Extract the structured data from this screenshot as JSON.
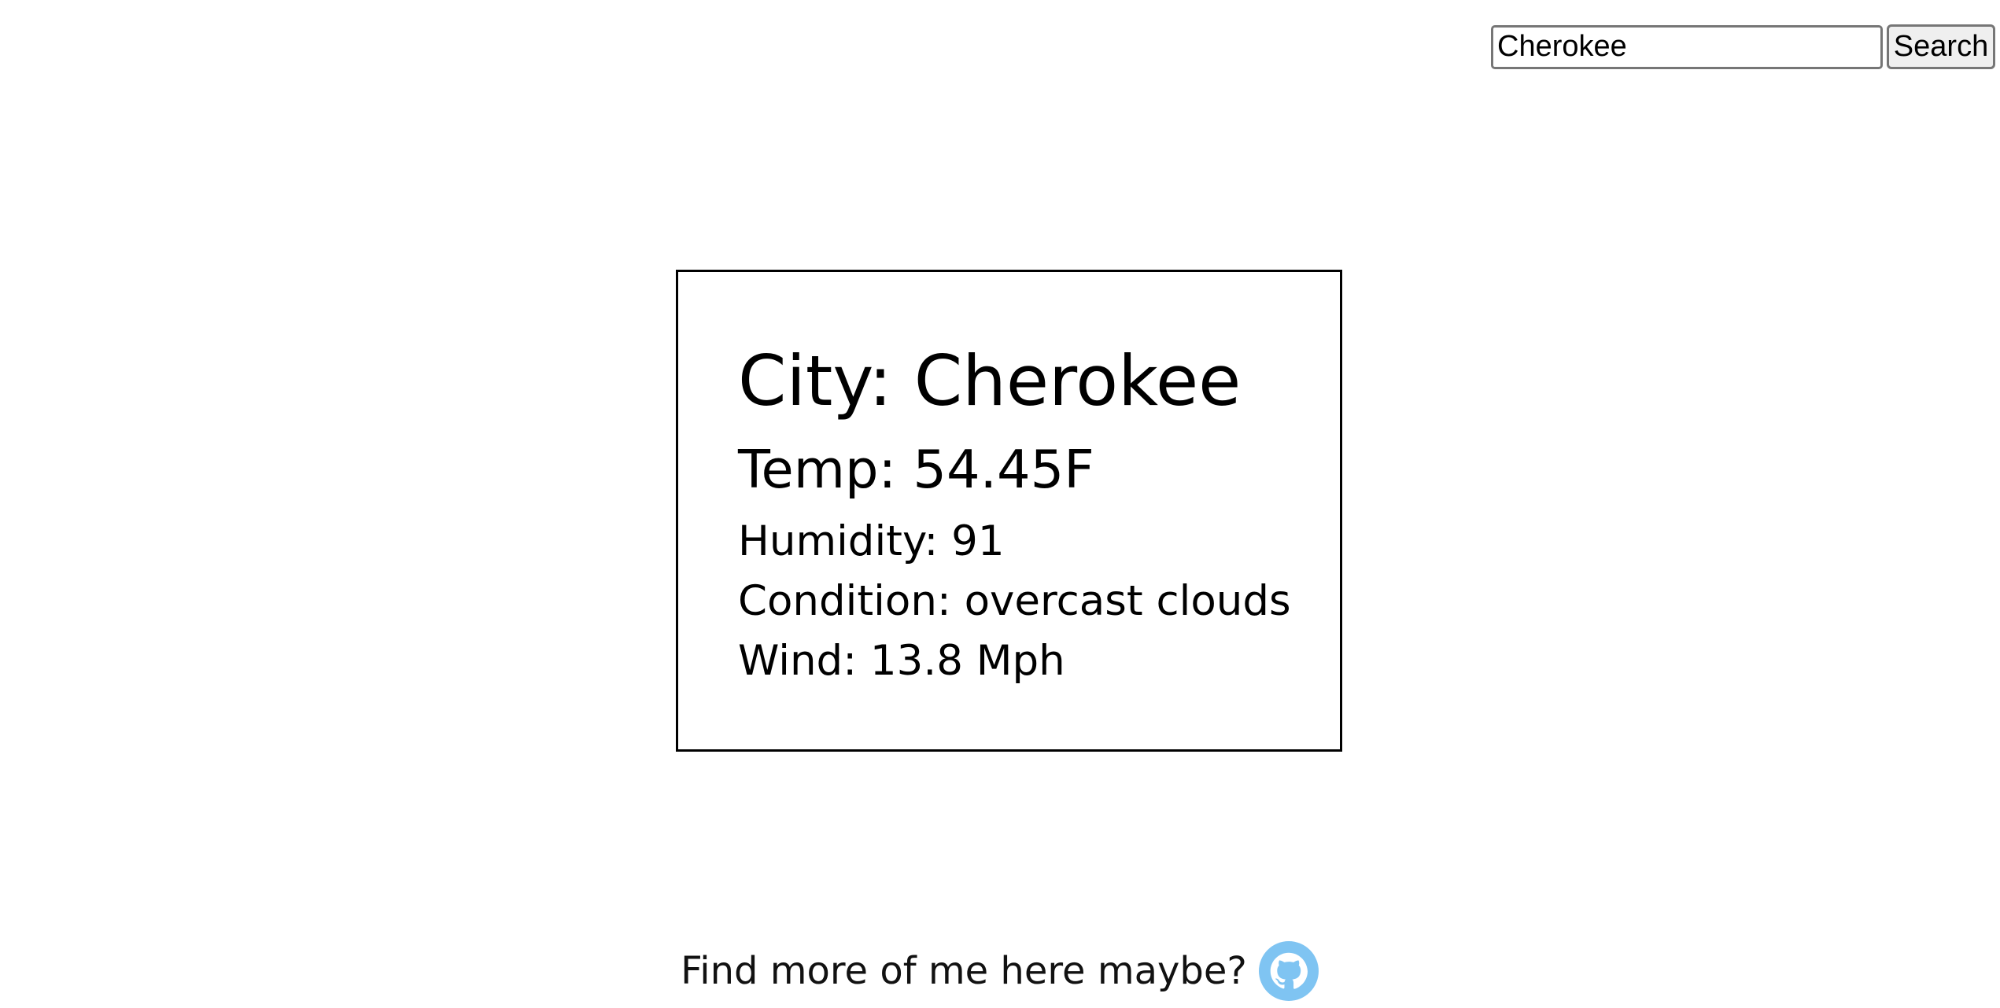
{
  "search": {
    "value": "Cherokee",
    "button_label": "Search"
  },
  "weather": {
    "city": "City: Cherokee",
    "temp": "Temp: 54.45F",
    "humidity": "Humidity: 91",
    "condition": "Condition: overcast clouds",
    "wind": "Wind: 13.8 Mph"
  },
  "footer": {
    "text": "Find more of me here maybe?",
    "icon": "github-icon",
    "icon_color": "#7fc4f2"
  }
}
